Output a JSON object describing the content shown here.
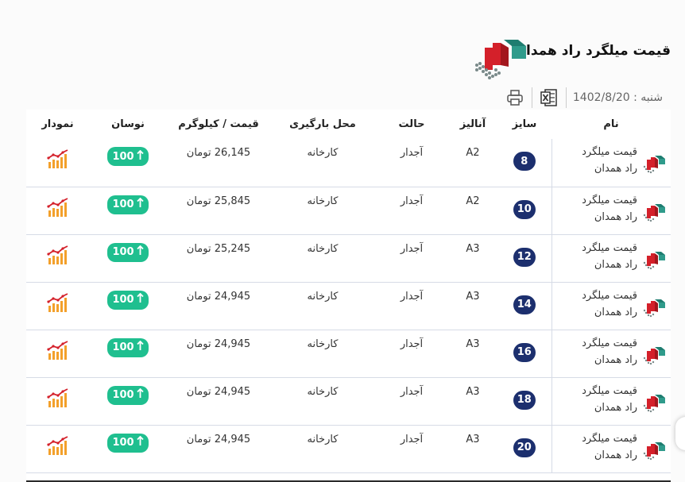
{
  "header": {
    "title": "قیمت میلگرد راد همدان",
    "date": "شنبه : 1402/8/20",
    "logo_icon": "brand-logo-icon",
    "excel_icon": "excel-export-icon",
    "print_icon": "print-icon"
  },
  "table": {
    "columns": {
      "name": "نام",
      "size": "سایز",
      "analysis": "آنالیز",
      "state": "حالت",
      "location": "محل بارگیری",
      "price": "قیمت / کیلوگرم",
      "change": "نوسان",
      "chart": "نمودار"
    },
    "rows": [
      {
        "name": "قیمت میلگرد راد همدان",
        "size": "8",
        "analysis": "A2",
        "state": "آجدار",
        "location": "کارخانه",
        "price": "26,145 تومان",
        "change": "100"
      },
      {
        "name": "قیمت میلگرد راد همدان",
        "size": "10",
        "analysis": "A2",
        "state": "آجدار",
        "location": "کارخانه",
        "price": "25,845 تومان",
        "change": "100"
      },
      {
        "name": "قیمت میلگرد راد همدان",
        "size": "12",
        "analysis": "A3",
        "state": "آجدار",
        "location": "کارخانه",
        "price": "25,245 تومان",
        "change": "100"
      },
      {
        "name": "قیمت میلگرد راد همدان",
        "size": "14",
        "analysis": "A3",
        "state": "آجدار",
        "location": "کارخانه",
        "price": "24,945 تومان",
        "change": "100"
      },
      {
        "name": "قیمت میلگرد راد همدان",
        "size": "16",
        "analysis": "A3",
        "state": "آجدار",
        "location": "کارخانه",
        "price": "24,945 تومان",
        "change": "100"
      },
      {
        "name": "قیمت میلگرد راد همدان",
        "size": "18",
        "analysis": "A3",
        "state": "آجدار",
        "location": "کارخانه",
        "price": "24,945 تومان",
        "change": "100"
      },
      {
        "name": "قیمت میلگرد راد همدان",
        "size": "20",
        "analysis": "A3",
        "state": "آجدار",
        "location": "کارخانه",
        "price": "24,945 تومان",
        "change": "100"
      }
    ]
  },
  "colors": {
    "badge": "#1c2f6e",
    "trend_up": "#1fbf8f",
    "logo_red": "#d4202a",
    "logo_teal": "#1e7d70",
    "chart_orange": "#f3a02b"
  },
  "icons": {
    "row_logo": "brand-logo-icon",
    "trend": "arrow-up-icon",
    "chart": "chart-icon"
  }
}
